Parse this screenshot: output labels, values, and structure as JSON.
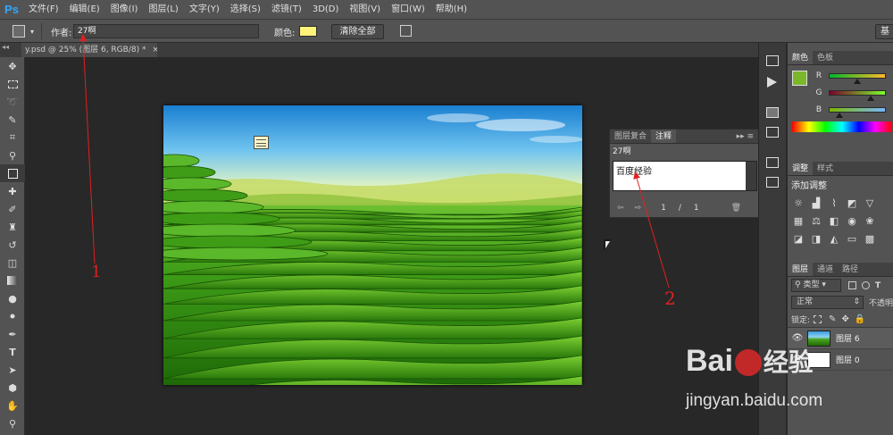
{
  "app": {
    "logo": "Ps"
  },
  "menu": [
    "文件(F)",
    "编辑(E)",
    "图像(I)",
    "图层(L)",
    "文字(Y)",
    "选择(S)",
    "滤镜(T)",
    "3D(D)",
    "视图(V)",
    "窗口(W)",
    "帮助(H)"
  ],
  "options": {
    "author_label": "作者:",
    "author_value": "27啊",
    "color_label": "颜色:",
    "note_color": "#fff27a",
    "clear_all": "清除全部",
    "workspace": "基"
  },
  "document": {
    "tab_title": "y.psd @ 25% (图层 6, RGB/8) *",
    "close": "×"
  },
  "notes_panel": {
    "tabs": [
      "图层复合",
      "注释"
    ],
    "author": "27啊",
    "note_text": "百度经验",
    "page_current": "1",
    "page_sep": "/",
    "page_total": "1"
  },
  "color_panel": {
    "tabs": [
      "颜色",
      "色板"
    ],
    "foreground": "#7ab72a",
    "channels": [
      {
        "name": "R",
        "value": 0.48
      },
      {
        "name": "G",
        "value": 0.72
      },
      {
        "name": "B",
        "value": 0.17
      }
    ]
  },
  "adjust_panel": {
    "tabs": [
      "调整",
      "样式"
    ],
    "title": "添加调整"
  },
  "layers_panel": {
    "tabs": [
      "图层",
      "通道",
      "路径"
    ],
    "filter_kind": "类型",
    "blend_mode": "正常",
    "opacity_label": "不透明",
    "lock_label": "锁定:",
    "layers": [
      {
        "name": "图层 6",
        "selected": true
      },
      {
        "name": "图层 0",
        "selected": false
      }
    ]
  },
  "annotations": {
    "label_1": "1",
    "label_2": "2"
  },
  "watermark": {
    "brand_1": "Bai",
    "brand_2": "经验",
    "url": "jingyan.baidu.com"
  }
}
